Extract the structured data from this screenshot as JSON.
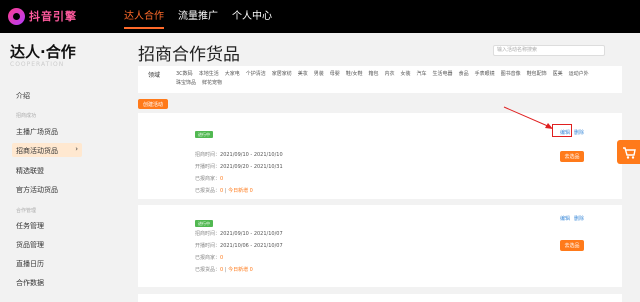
{
  "header": {
    "logo_text": "抖音引擎",
    "nav": [
      "达人合作",
      "流量推广",
      "个人中心"
    ]
  },
  "sidebar": {
    "brand": "达人·合作",
    "brand_sub": "COOPERATION",
    "intro": "介绍",
    "group1": "招商成功",
    "items1": [
      "主播广场货品",
      "招商活动货品",
      "精选联盟",
      "官方活动货品"
    ],
    "group2": "合作管理",
    "items2": [
      "任务管理",
      "货品管理",
      "直播日历",
      "合作数据"
    ]
  },
  "main": {
    "title": "招商合作货品",
    "search_placeholder": "输入活动名称搜索",
    "filter_label": "领域",
    "categories": [
      "3C数码",
      "本地生活",
      "大家电",
      "个护清洁",
      "家居家纺",
      "美妆",
      "男装",
      "母婴",
      "鞋/女鞋",
      "箱包",
      "内衣",
      "女装",
      "汽车",
      "生活电器",
      "食品",
      "手表眼镜",
      "图书音像",
      "鞋包配饰",
      "医美",
      "运动户外",
      "珠宝饰品",
      "鲜花宠物"
    ],
    "create_btn": "创建活动",
    "cards": [
      {
        "badge": "进行中",
        "rows": [
          {
            "label": "招商时间：",
            "value": "2021/09/10 - 2021/10/10"
          },
          {
            "label": "开播时间：",
            "value": "2021/09/20 - 2021/10/31"
          },
          {
            "label": "已报商家：",
            "value": "0"
          },
          {
            "label": "已报货品：",
            "value": "0",
            "sep": "|",
            "extra": "今日新增 0"
          }
        ],
        "actions": [
          "编辑",
          "删除"
        ],
        "button": "去选品"
      },
      {
        "badge": "进行中",
        "rows": [
          {
            "label": "招商时间：",
            "value": "2021/09/10 - 2021/10/07"
          },
          {
            "label": "开播时间：",
            "value": "2021/10/06 - 2021/10/07"
          },
          {
            "label": "已报商家：",
            "value": "0"
          },
          {
            "label": "已报货品：",
            "value": "0",
            "sep": "|",
            "extra": "今日新增 0"
          }
        ],
        "actions": [
          "编辑",
          "删除"
        ],
        "button": "去选品"
      }
    ]
  },
  "colors": {
    "accent": "#ff7a1a",
    "active_nav": "#ff6a2a",
    "badge": "#51b851",
    "link": "#3d8bd9",
    "highlight": "#e02020"
  },
  "icons": {
    "cart": "cart-icon",
    "chevron": "chevron-right-icon"
  }
}
